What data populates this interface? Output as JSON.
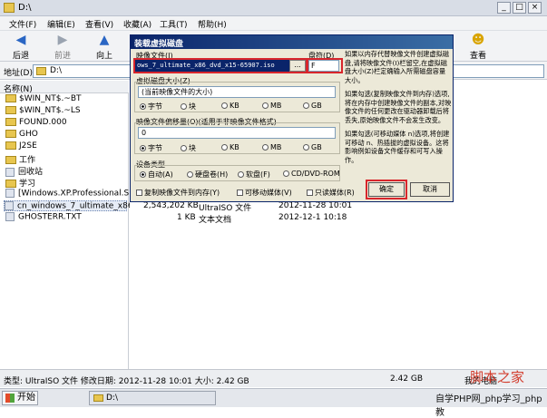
{
  "window": {
    "title": "D:\\"
  },
  "menu": [
    "文件(F)",
    "编辑(E)",
    "查看(V)",
    "收藏(A)",
    "工具(T)",
    "帮助(H)"
  ],
  "toolbar": {
    "back": "后退",
    "forward": "前进",
    "up": "向上",
    "view": "查看"
  },
  "address": {
    "label": "地址(D)",
    "value": "D:\\"
  },
  "tree": {
    "header": "名称(N)",
    "items": [
      "$WIN_NT$.~BT",
      "$WIN_NT$.~LS",
      "FOUND.000",
      "GHO",
      "J2SE",
      "工作",
      "回收站",
      "学习",
      "[Windows.XP.Professional.SP...",
      "cn_windows_7_ultimate_x86_...",
      "GHOSTERR.TXT"
    ]
  },
  "files": [
    {
      "size": "2,543,202 KB",
      "type": "UltraISO 文件",
      "date": "2012-11-28 10:01"
    },
    {
      "size": "1 KB",
      "type": "文本文档",
      "date": "2012-12-1 10:18"
    }
  ],
  "dialog": {
    "title": "装载虚拟磁盘",
    "image_file_label": "映像文件(I)",
    "image_file_value": "ows_7_ultimate_x86_dvd_x15-65907.iso",
    "browse": "...",
    "drive_label": "盘符(D)",
    "drive_value": "F",
    "vsize_label": "虚拟磁盘大小(Z)",
    "vsize_value": "(当前映像文件的大小)",
    "units": [
      "字节",
      "块",
      "KB",
      "MB",
      "GB"
    ],
    "offset_label": "映像文件偏移量(O)(适用于非映像文件格式)",
    "offset_value": "0",
    "device_label": "设备类型",
    "devices": [
      "自动(A)",
      "硬盘卷(H)",
      "软盘(F)",
      "CD/DVD-ROM"
    ],
    "check_copy": "复制映像文件到内存(Y)",
    "check_removable": "可移动媒体(V)",
    "check_readonly": "只读媒体(R)",
    "ok": "确定",
    "cancel": "取消",
    "help1": "如果以内存代替映像文件创建虚拟磁盘,请将映像文件(I)栏留空,在虚拟磁盘大小(Z)栏定确输入所需磁盘容量大小。",
    "help2": "如果勾选(复制映像文件到内存)选项,将在内存中创建映像文件的副本,对映像文件的任何更改在驱动器卸载后将丢失,原始映像文件不会发生改变。",
    "help3": "如果勾选(可移动媒体 n)选项,将创建可移动 n、热插拔的虚拟设备。这将影响例如设备文件缓存和可写入操作。"
  },
  "statusbar": {
    "text": "类型: UltraISO 文件 修改日期: 2012-11-28 10:01 大小: 2.42 GB",
    "size": "2.42 GB",
    "location": "我的电脑"
  },
  "taskbar": {
    "start": "开始",
    "window": "D:\\"
  },
  "watermarks": {
    "top": "脚本之家",
    "bottom": "自学PHP网_php学习_php教"
  }
}
